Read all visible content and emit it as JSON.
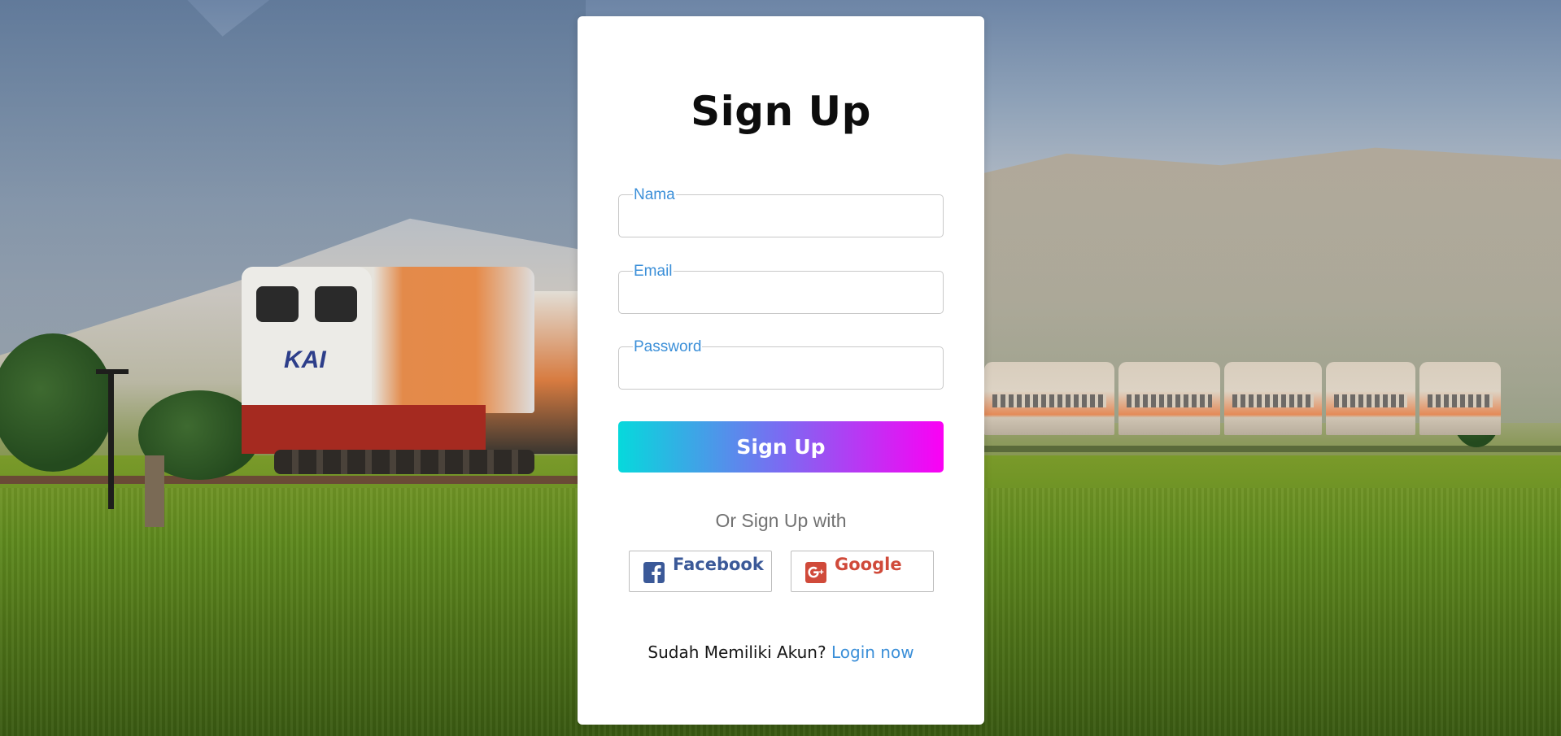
{
  "form": {
    "title": "Sign Up",
    "fields": {
      "name": {
        "label": "Nama",
        "value": ""
      },
      "email": {
        "label": "Email",
        "value": ""
      },
      "password": {
        "label": "Password",
        "value": ""
      }
    },
    "submit_label": "Sign Up",
    "or_text": "Or Sign Up with",
    "social": {
      "facebook": {
        "label": "Facebook",
        "icon": "facebook-icon",
        "color": "#3b5998"
      },
      "google": {
        "label": "Google",
        "icon": "google-plus-icon",
        "color": "#d04a3a"
      }
    },
    "login_prompt": "Sudah Memiliki Akun?",
    "login_link": "Login now"
  },
  "background": {
    "photo_text": "KAI"
  },
  "colors": {
    "accent": "#3b8fd8",
    "gradient_start": "#06d9dc",
    "gradient_end": "#fb00f4"
  }
}
